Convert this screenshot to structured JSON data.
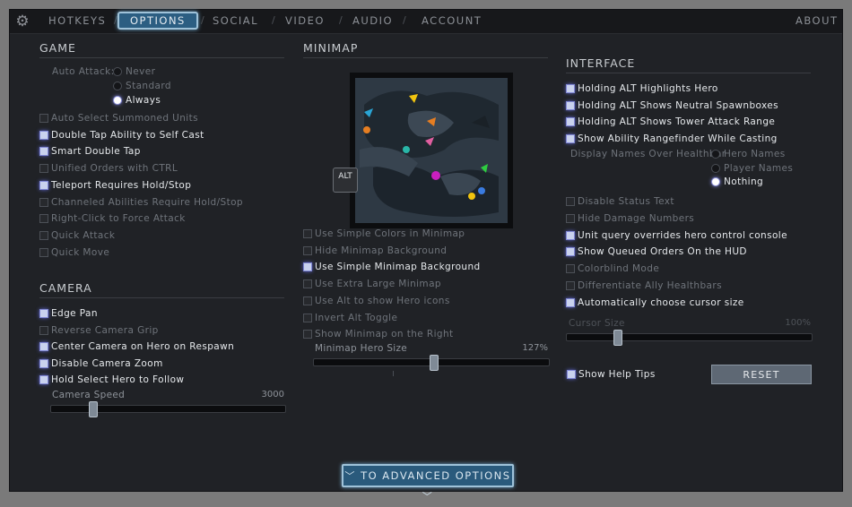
{
  "tabs": [
    {
      "label": "HOTKEYS"
    },
    {
      "label": "OPTIONS"
    },
    {
      "label": "SOCIAL"
    },
    {
      "label": "VIDEO"
    },
    {
      "label": "AUDIO"
    },
    {
      "label": "ACCOUNT"
    }
  ],
  "about_label": "ABOUT",
  "separator": "/",
  "game": {
    "title": "GAME",
    "auto_attack_label": "Auto Attack:",
    "auto_attack_options": [
      "Never",
      "Standard",
      "Always"
    ],
    "auto_attack_selected": "Always",
    "options": [
      {
        "label": "Auto Select Summoned Units",
        "checked": false
      },
      {
        "label": "Double Tap Ability to Self Cast",
        "checked": true
      },
      {
        "label": "Smart Double Tap",
        "checked": true
      },
      {
        "label": "Unified Orders with CTRL",
        "checked": false
      },
      {
        "label": "Teleport Requires Hold/Stop",
        "checked": true
      },
      {
        "label": "Channeled Abilities Require Hold/Stop",
        "checked": false
      },
      {
        "label": "Right-Click to Force Attack",
        "checked": false
      },
      {
        "label": "Quick Attack",
        "checked": false
      },
      {
        "label": "Quick Move",
        "checked": false
      }
    ]
  },
  "camera": {
    "title": "CAMERA",
    "options": [
      {
        "label": "Edge Pan",
        "checked": true
      },
      {
        "label": "Reverse Camera Grip",
        "checked": false
      },
      {
        "label": "Center Camera on Hero on Respawn",
        "checked": true
      },
      {
        "label": "Disable Camera Zoom",
        "checked": true
      },
      {
        "label": "Hold Select Hero to Follow",
        "checked": true
      }
    ],
    "speed_label": "Camera Speed",
    "speed_value": "3000",
    "speed_fraction": 0.18
  },
  "minimap": {
    "title": "MINIMAP",
    "alt_label": "ALT",
    "options": [
      {
        "label": "Use Simple Colors in Minimap",
        "checked": false
      },
      {
        "label": "Hide Minimap Background",
        "checked": false
      },
      {
        "label": "Use Simple Minimap Background",
        "checked": true
      },
      {
        "label": "Use Extra Large Minimap",
        "checked": false
      },
      {
        "label": "Use Alt to show Hero icons",
        "checked": false
      },
      {
        "label": "Invert Alt Toggle",
        "checked": false
      },
      {
        "label": "Show Minimap on the Right",
        "checked": false
      }
    ],
    "hero_size_label": "Minimap Hero Size",
    "hero_size_value": "127%",
    "hero_size_fraction": 0.51
  },
  "interface": {
    "title": "INTERFACE",
    "options_top": [
      {
        "label": "Holding ALT Highlights Hero",
        "checked": true
      },
      {
        "label": "Holding ALT Shows Neutral Spawnboxes",
        "checked": true
      },
      {
        "label": "Holding ALT Shows Tower Attack Range",
        "checked": true
      },
      {
        "label": "Show Ability Rangefinder While Casting",
        "checked": true
      }
    ],
    "names_label": "Display Names Over Healthbar",
    "names_options": [
      "Hero Names",
      "Player Names",
      "Nothing"
    ],
    "names_selected": "Nothing",
    "options_bottom": [
      {
        "label": "Disable Status Text",
        "checked": false
      },
      {
        "label": "Hide Damage Numbers",
        "checked": false
      },
      {
        "label": "Unit query overrides hero control console",
        "checked": true
      },
      {
        "label": "Show Queued Orders On the HUD",
        "checked": true
      },
      {
        "label": "Colorblind Mode",
        "checked": false
      },
      {
        "label": "Differentiate Ally Healthbars",
        "checked": false
      },
      {
        "label": "Automatically choose cursor size",
        "checked": true
      }
    ],
    "cursor_label": "Cursor Size",
    "cursor_value": "100%",
    "cursor_fraction": 0.21,
    "help_tips": {
      "label": "Show Help Tips",
      "checked": true
    },
    "reset_label": "RESET"
  },
  "advanced_label": "TO ADVANCED OPTIONS"
}
